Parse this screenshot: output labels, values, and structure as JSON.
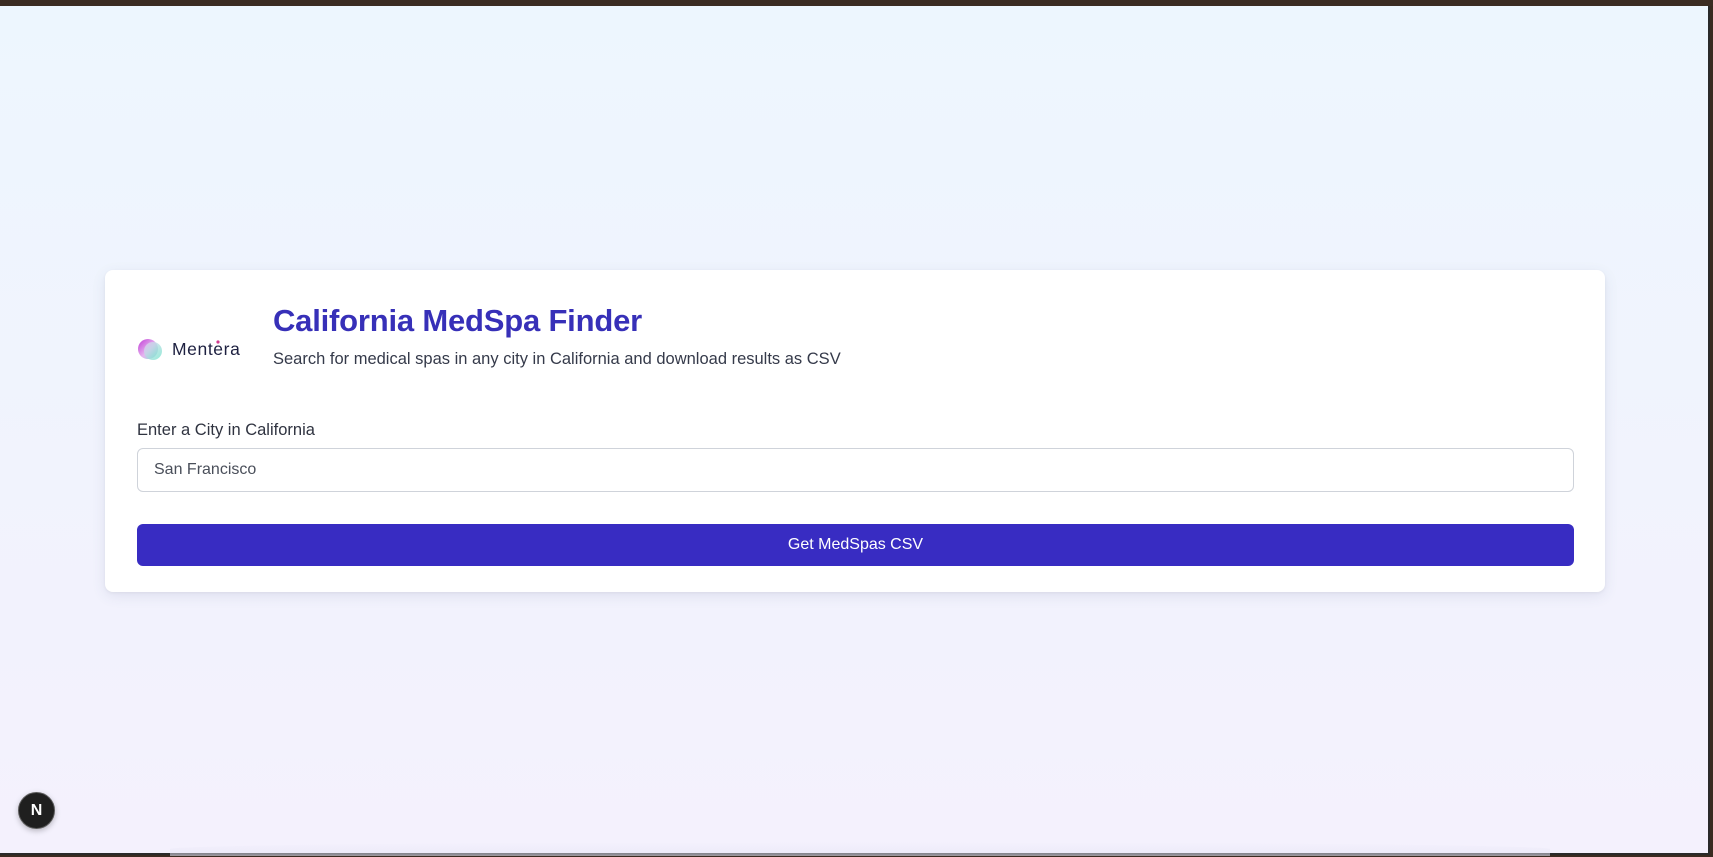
{
  "brand": {
    "logo_text": "Mentera"
  },
  "header": {
    "title": "California MedSpa Finder",
    "subtitle": "Search for medical spas in any city in California and download results as CSV"
  },
  "form": {
    "city_label": "Enter a City in California",
    "city_value": "San Francisco",
    "city_placeholder": "San Francisco",
    "submit_label": "Get MedSpas CSV"
  },
  "dev_badge": {
    "label": "N",
    "icon": "nextjs-icon"
  },
  "colors": {
    "title": "#3730b8",
    "button": "#382cc2",
    "background_top": "#edf6fe",
    "background_bottom": "#f4f1fd"
  }
}
